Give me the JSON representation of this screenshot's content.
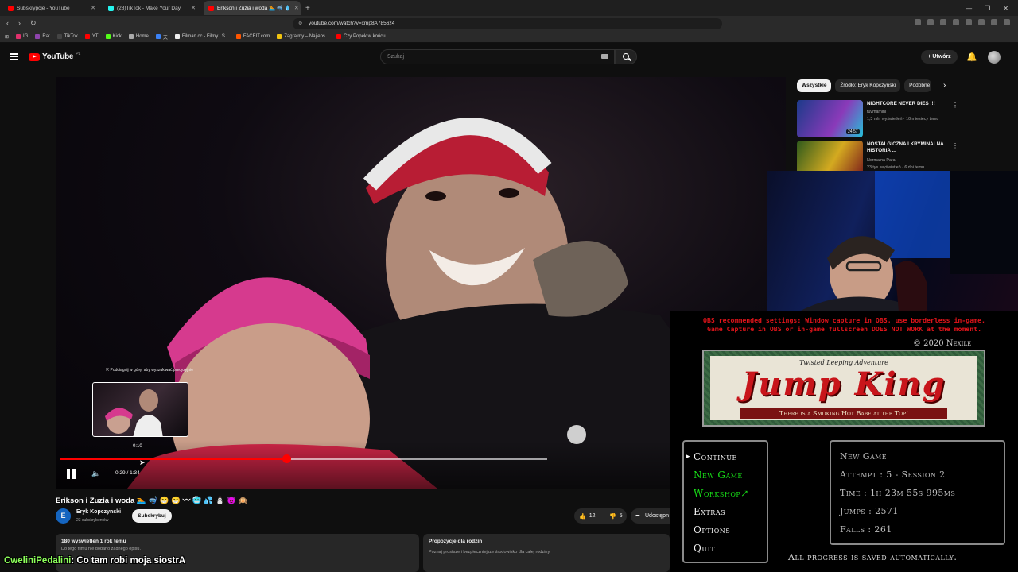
{
  "browser": {
    "tabs": [
      {
        "title": "Subskrypcje - YouTube",
        "color": "#ff0000",
        "active": false
      },
      {
        "title": "(28)TikTok - Make Your Day",
        "color": "#25f4ee",
        "active": false
      },
      {
        "title": "Erikson i Zuzia i woda 🏊 🤿 💧",
        "color": "#ff0000",
        "active": true
      }
    ],
    "url": "youtube.com/watch?v=xmp8A7856z4",
    "bookmarks": [
      {
        "label": "IG",
        "color": "#e1306c"
      },
      {
        "label": "Rat",
        "color": "#8e44ad"
      },
      {
        "label": "TikTok",
        "color": "#222222"
      },
      {
        "label": "YT",
        "color": "#ff0000"
      },
      {
        "label": "Kick",
        "color": "#53fc18"
      },
      {
        "label": "Home",
        "color": "#aaaaaa"
      },
      {
        "label": "天",
        "color": "#3b82f6"
      },
      {
        "label": "Filman.cc - Filmy i S...",
        "color": "#eeeeee"
      },
      {
        "label": "FACEIT.com",
        "color": "#ff5500"
      },
      {
        "label": "Zagrajmy – Najleps...",
        "color": "#f1c40f"
      },
      {
        "label": "Czy Popek w końcu...",
        "color": "#ff0000"
      }
    ]
  },
  "youtube": {
    "logo_text": "YouTube",
    "logo_region": "PL",
    "search_placeholder": "Szukaj",
    "create_label": "+ Utwórz"
  },
  "player": {
    "preview_hint": "⇱ Podciągnij w górę, aby wyszukiwać precyzyjnie",
    "preview_time": "0:10",
    "time_display": "0:29 / 1:34",
    "played_fraction": 0.465,
    "buffered_fraction": 1.0
  },
  "video": {
    "title": "Erikson i Zuzia i woda 🏊 🤿 😁 😁 〰 🥶 💦 ⛄ 😈 🙉",
    "channel_initial": "E",
    "channel": "Eryk Kopczynski",
    "subscribers": "23 subskrybentów",
    "subscribe_label": "Subskrybuj",
    "likes": "12",
    "dislikes": "5",
    "share_label": "Udostępn",
    "views": "180 wyświetleń  1 rok temu",
    "no_description": "Do tego filmu nie dodano żadnego opisu.",
    "family_title": "Propozycje dla rodzin",
    "family_text": "Poznaj prostsze i bezpieczniejsze środowisko dla całej rodziny"
  },
  "sidebar": {
    "chips": [
      "Wszystkie",
      "Źródło: Eryk Kopczynski",
      "Podobne"
    ],
    "recommendations": [
      {
        "title": "NIGHTCORE NEVER DIES !!!",
        "channel": "tuvmamini",
        "meta": "1,3 mln wyświetleń · 10 miesięcy temu",
        "duration": "24:57",
        "color1": "#1c3a8a",
        "color2": "#8a3ab9"
      },
      {
        "title": "NOSTALGICZNA I KRYMINALNA HISTORIA ...",
        "channel": "Normalna Para",
        "meta": "23 tys. wyświetleń · 6 dni temu",
        "duration": "",
        "color1": "#2e5a1c",
        "color2": "#d4aa20"
      }
    ]
  },
  "game": {
    "obs_warning_line1": "OBS recommended settings: Window capture in OBS, use borderless in-game.",
    "obs_warning_line2": "Game Capture in OBS or in-game fullscreen DOES NOT WORK at the moment.",
    "copyright": "© 2020 Nexile",
    "banner_subtitle": "Twisted Leeping Adventure",
    "banner_title": "Jump King",
    "banner_ribbon": "There is a Smoking Hot Babe at the Top!",
    "menu": [
      "Continue",
      "New Game",
      "Workshop↗",
      "Extras",
      "Options",
      "Quit"
    ],
    "stats": [
      "New Game",
      "Attempt : 5  - Session 2",
      "Time : 1h 23m 55s 995ms",
      "Jumps : 2571",
      "Falls : 261"
    ],
    "saved_notice": "All progress is saved automatically."
  },
  "chat": {
    "user": "CweliniPedalini",
    "message": ": Co tam robi moja siostrA"
  }
}
